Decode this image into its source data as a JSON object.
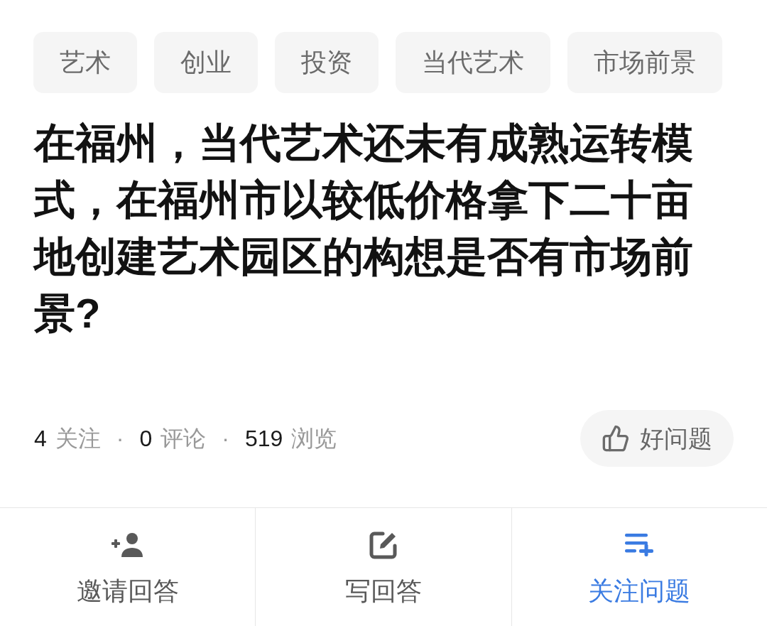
{
  "tags": [
    "艺术",
    "创业",
    "投资",
    "当代艺术",
    "市场前景"
  ],
  "question": {
    "title": "在福州，当代艺术还未有成熟运转模式，在福州市以较低价格拿下二十亩地创建艺术园区的构想是否有市场前景?"
  },
  "stats": [
    {
      "kind": "stat",
      "count": "4",
      "label": "关注"
    },
    {
      "kind": "separator",
      "text": "·"
    },
    {
      "kind": "stat",
      "count": "0",
      "label": "评论"
    },
    {
      "kind": "separator",
      "text": "·"
    },
    {
      "kind": "stat",
      "count": "519",
      "label": "浏览"
    }
  ],
  "good_question_button": {
    "label": "好问题"
  },
  "bottom_actions": [
    {
      "kind": "invite",
      "label": "邀请回答",
      "highlighted": false
    },
    {
      "kind": "write",
      "label": "写回答",
      "highlighted": false
    },
    {
      "kind": "follow",
      "label": "关注问题",
      "highlighted": true
    }
  ]
}
